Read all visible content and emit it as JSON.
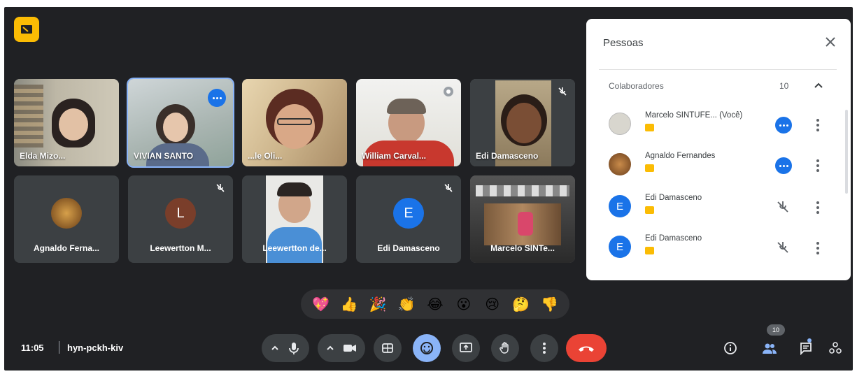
{
  "meeting": {
    "time": "11:05",
    "code": "hyn-pckh-kiv",
    "participant_count": "10"
  },
  "tiles": [
    {
      "name": "Elda Mizo...",
      "kind": "video"
    },
    {
      "name": "VIVIAN SANTO",
      "kind": "video"
    },
    {
      "name": "...le Oli...",
      "kind": "video"
    },
    {
      "name": "William Carval...",
      "kind": "video"
    },
    {
      "name": "Edi Damasceno",
      "kind": "video"
    },
    {
      "name": "Agnaldo Ferna...",
      "kind": "avatar"
    },
    {
      "name": "Leewertton M...",
      "kind": "avatar",
      "initial": "L"
    },
    {
      "name": "Leewertton de...",
      "kind": "video"
    },
    {
      "name": "Edi Damasceno",
      "kind": "avatar",
      "initial": "E"
    },
    {
      "name": "Marcelo SINTe...",
      "kind": "video"
    }
  ],
  "panel": {
    "title": "Pessoas",
    "group_label": "Colaboradores",
    "group_count": "10",
    "people": [
      {
        "name": "Marcelo SINTUFE... (Você)",
        "status": "speaking"
      },
      {
        "name": "Agnaldo Fernandes",
        "status": "speaking"
      },
      {
        "name": "Edi Damasceno",
        "initial": "E",
        "status": "muted"
      },
      {
        "name": "Edi Damasceno",
        "initial": "E",
        "status": "muted"
      }
    ]
  },
  "reactions": [
    "💖",
    "👍",
    "🎉",
    "👏",
    "😂",
    "😮",
    "😢",
    "🤔",
    "👎"
  ],
  "colors": {
    "background": "#202124",
    "tile": "#3c4043",
    "accent_blue": "#8ab4f8",
    "end_call": "#ea4335",
    "tag_yellow": "#fbbc04",
    "avatar_blue": "#1a73e8",
    "avatar_brown": "#7a3e2a"
  },
  "icons": [
    "info-icon",
    "people-icon",
    "chat-icon",
    "activities-icon",
    "mic-icon",
    "camera-icon",
    "captions-icon",
    "emoji-icon",
    "present-icon",
    "raise-hand-icon",
    "more-options-icon",
    "end-call-icon"
  ]
}
